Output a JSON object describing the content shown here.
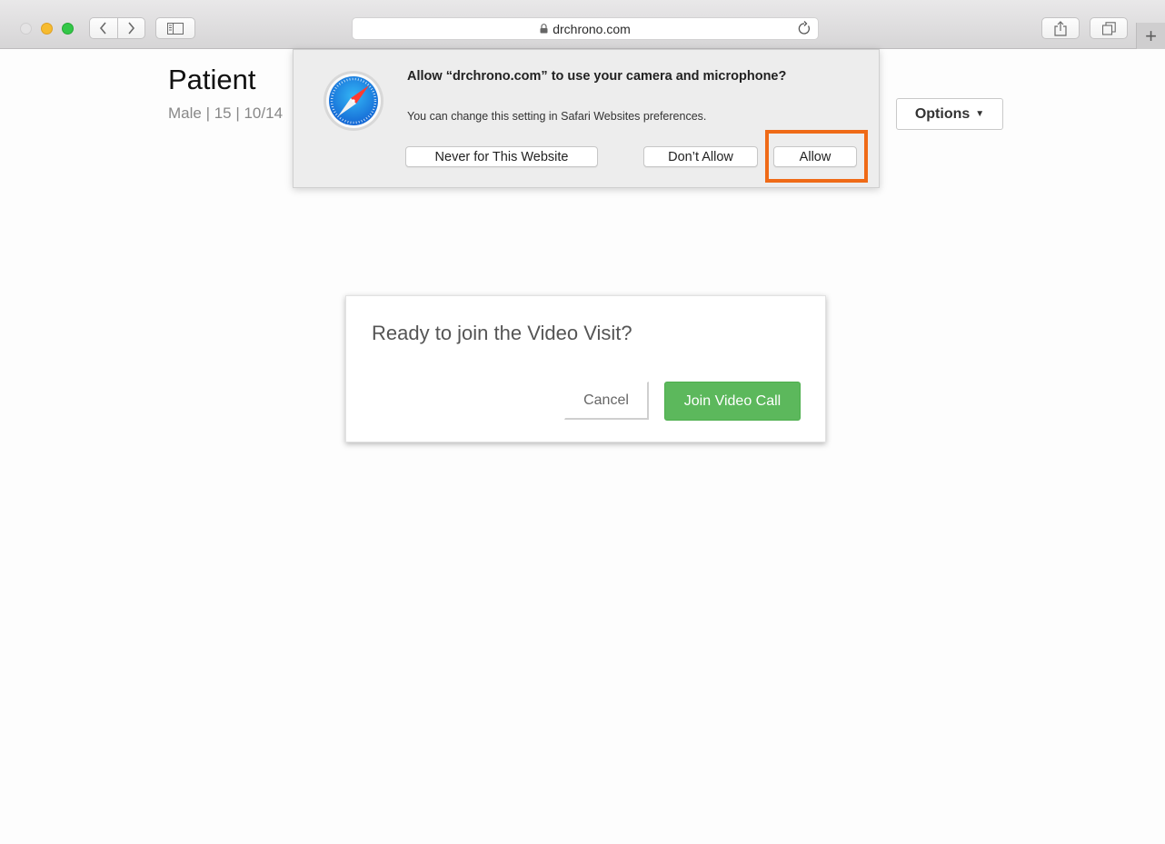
{
  "browser": {
    "address": "drchrono.com",
    "new_tab_label": "+"
  },
  "page": {
    "title": "Patient",
    "subtitle": "Male | 15 | 10/14",
    "options_label": "Options"
  },
  "permission_prompt": {
    "title": "Allow “drchrono.com” to use your camera and microphone?",
    "description": "You can change this setting in Safari Websites preferences.",
    "never_label": "Never for This Website",
    "dont_allow_label": "Don’t Allow",
    "allow_label": "Allow",
    "highlight_color": "#ef6a17"
  },
  "video_modal": {
    "title": "Ready to join the Video Visit?",
    "cancel_label": "Cancel",
    "join_label": "Join Video Call",
    "join_color": "#5cb85c"
  },
  "icons": [
    "back-icon",
    "forward-icon",
    "sidebar-icon",
    "lock-icon",
    "reload-icon",
    "share-icon",
    "tabs-icon",
    "safari-compass-icon",
    "caret-down-icon"
  ]
}
